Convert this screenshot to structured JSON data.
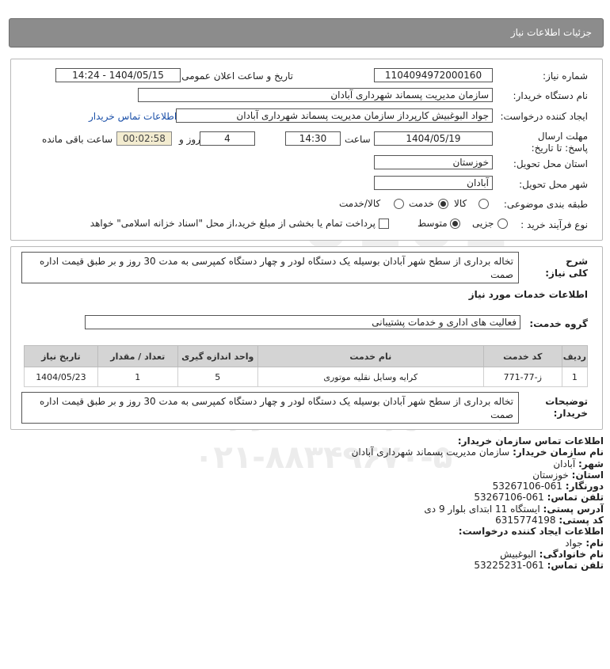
{
  "header": {
    "title": "جزئیات اطلاعات نیاز"
  },
  "form": {
    "need_number_label": "شماره نیاز:",
    "need_number": "1104094972000160",
    "announce_label": "تاریخ و ساعت اعلان عمومی:",
    "announce_value": "1404/05/15 - 14:24",
    "buyer_org_label": "نام دستگاه خریدار:",
    "buyer_org": "سازمان مدیریت پسماند شهرداری آبادان",
    "requester_label": "ایجاد کننده درخواست:",
    "requester": "جواد البوغبیش کارپرداز سازمان مدیریت پسماند شهرداری آبادان",
    "contact_link": "اطلاعات تماس خریدار",
    "deadline_label": "مهلت ارسال پاسخ: تا تاریخ:",
    "deadline_date": "1404/05/19",
    "time_label": "ساعت",
    "deadline_time": "14:30",
    "days_value": "4",
    "days_label": "روز و",
    "remaining_time": "00:02:58",
    "remaining_label": "ساعت باقی مانده",
    "province_label": "استان محل تحویل:",
    "province": "خوزستان",
    "city_label": "شهر محل تحویل:",
    "city": "آبادان",
    "category_label": "طبقه بندی موضوعی:",
    "category_options": [
      "کالا",
      "خدمت",
      "کالا/خدمت"
    ],
    "category_selected": "خدمت",
    "process_label": "نوع فرآیند خرید :",
    "process_options": [
      "جزیی",
      "متوسط"
    ],
    "process_selected": "متوسط",
    "payment_note": "پرداخت تمام یا بخشی از مبلغ خرید،از محل \"اسناد خزانه اسلامی\" خواهد بود."
  },
  "summary": {
    "label": "شرح کلی نیاز:",
    "text": "تخاله برداری از سطح شهر آبادان بوسیله یک دستگاه لودر و چهار دستگاه کمپرسی به مدت 30 روز و بر طبق قیمت اداره صمت"
  },
  "services": {
    "section_title": "اطلاعات خدمات مورد نیاز",
    "group_label": "گروه خدمت:",
    "group_value": "فعالیت های اداری و خدمات پشتیبانی",
    "table": {
      "headers": [
        "ردیف",
        "کد خدمت",
        "نام خدمت",
        "واحد اندازه گیری",
        "تعداد / مقدار",
        "تاریخ نیاز"
      ],
      "rows": [
        [
          "1",
          "ز-77-771",
          "کرایه وسایل نقلیه موتوری",
          "5",
          "1",
          "1404/05/23"
        ]
      ]
    }
  },
  "buyer_notes": {
    "label": "توضیحات خریدار:",
    "text": "تخاله برداری از سطح شهر آبادان بوسیله یک دستگاه لودر و چهار دستگاه کمپرسی به مدت 30 روز و بر طبق قیمت اداره صمت"
  },
  "contact": {
    "title": "اطلاعات تماس سازمان خریدار:",
    "org_label": "نام سازمان خریدار:",
    "org": "سازمان مدیریت پسماند شهرداری آبادان",
    "city_label": "شهر:",
    "city": "آبادان",
    "province_label": "استان:",
    "province": "خوزستان",
    "fax_label": "دورنگار:",
    "fax": "061-53267106",
    "phone_label": "تلفن تماس:",
    "phone": "061-53267106",
    "address_label": "آدرس پستی:",
    "address": "ایستگاه 11 ابتدای بلوار 9 دی",
    "postal_label": "کد پستی:",
    "postal": "6315774198",
    "creator_title": "اطلاعات ایجاد کننده درخواست:",
    "name_label": "نام:",
    "name": "جواد",
    "family_label": "نام خانوادگی:",
    "family": "البوغبیش",
    "creator_phone_label": "تلفن تماس:",
    "creator_phone": "061-53225231"
  },
  "watermark": {
    "brand": "ParsNamadData",
    "tagline": "پایگاه اطلاع رسانی مناقصه ومزایده",
    "phone": "۰۲۱-۸۸۳۴۹۶۷۰-۵",
    "numbers": "0101"
  }
}
